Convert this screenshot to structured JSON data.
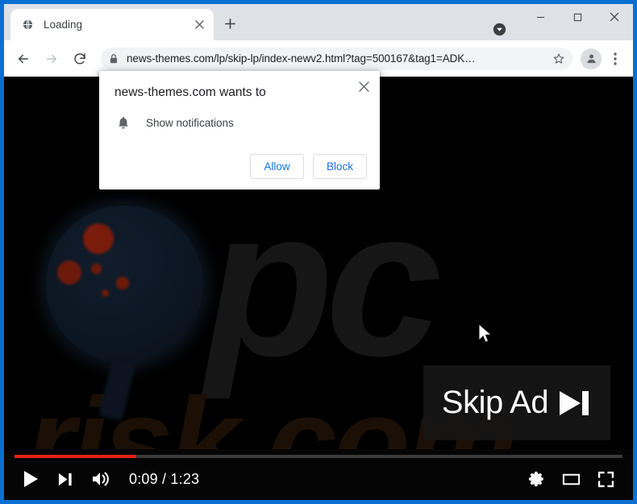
{
  "window": {
    "frame_color": "#0a6fd1",
    "controls": {
      "minimize": "–",
      "maximize": "□",
      "close": "✕"
    }
  },
  "tabstrip": {
    "tabs": [
      {
        "title": "Loading",
        "favicon": "globe-icon",
        "close_label": "✕"
      }
    ],
    "new_tab_label": "+",
    "tab_search_icon": "chevron-down-circle-icon"
  },
  "toolbar": {
    "back_icon": "arrow-left-icon",
    "forward_icon": "arrow-right-icon",
    "reload_icon": "reload-icon",
    "lock_icon": "lock-icon",
    "url": "news-themes.com/lp/skip-lp/index-newv2.html?tag=500167&tag1=ADK…",
    "star_icon": "star-icon",
    "profile_icon": "avatar-icon",
    "menu_icon": "three-dots-icon"
  },
  "permission_dialog": {
    "title": "news-themes.com wants to",
    "request_icon": "bell-icon",
    "request_label": "Show notifications",
    "allow_label": "Allow",
    "block_label": "Block",
    "close_label": "✕",
    "accent_color": "#1a73e8"
  },
  "page": {
    "watermark_primary": "pc",
    "watermark_secondary": "risk.com",
    "skip_ad": {
      "label": "Skip Ad",
      "glyph": "skip-forward-icon"
    }
  },
  "player": {
    "play_icon": "play-icon",
    "next_icon": "next-track-icon",
    "volume_icon": "volume-icon",
    "time_display": "0:09 / 1:23",
    "current_time": "0:09",
    "duration": "1:23",
    "progress_percent": 20,
    "progress_color": "#e62117",
    "settings_icon": "gear-icon",
    "theater_icon": "theater-mode-icon",
    "fullscreen_icon": "fullscreen-icon"
  }
}
